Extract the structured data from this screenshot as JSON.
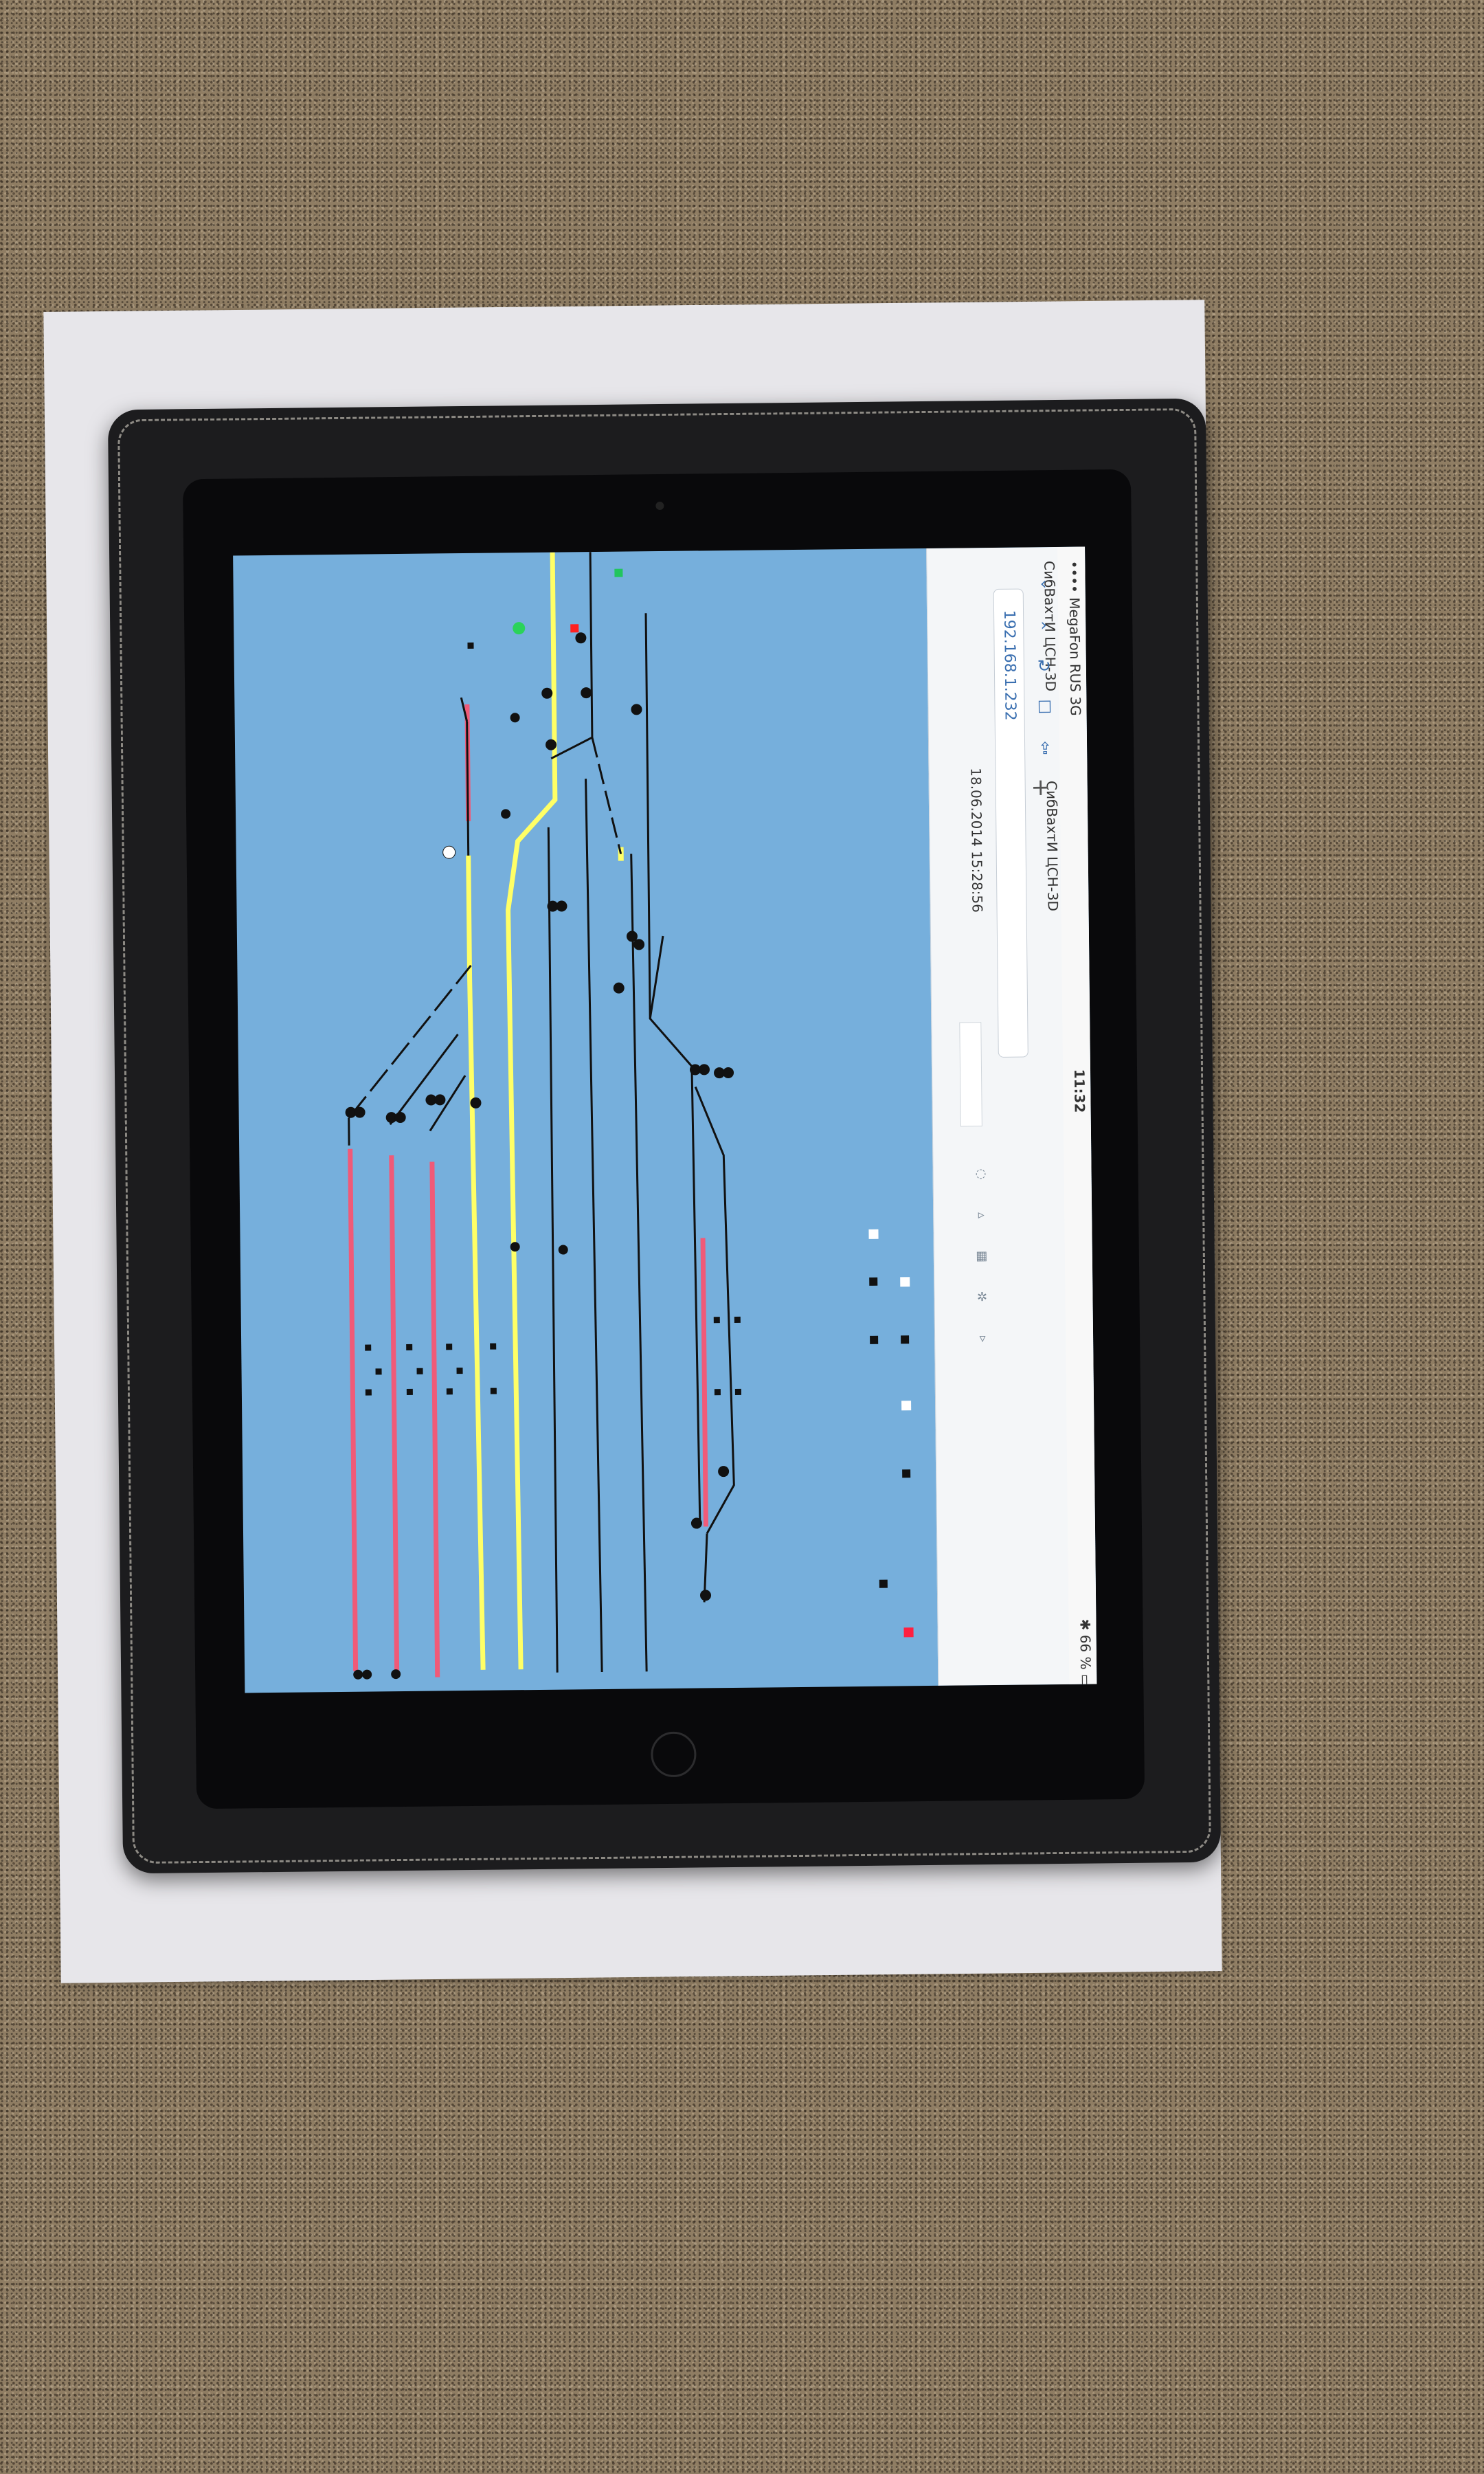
{
  "status_bar": {
    "carrier": "•••• MegaFon RUS 3G",
    "clock": "11:32",
    "battery": "✱ 66 % ▭"
  },
  "browser": {
    "tab_title": "СибВахтИ ЦСН-3D",
    "tab_title_2": "СибВахтИ ЦСН-3D",
    "url": "192.168.1.232",
    "timestamp": "18.06.2014 15:28:56",
    "nav_icons": [
      "back-icon",
      "forward-icon",
      "reload-icon",
      "bookmarks-icon",
      "share-icon",
      "tabs-icon"
    ]
  },
  "schematic": {
    "track_colors": {
      "occupied": "#f05a78",
      "route_set": "#ffff66",
      "free": "#111111",
      "background": "#76afdc"
    },
    "signal_aspects": [
      "green",
      "red",
      "white",
      "yellow"
    ],
    "legend_icons": [
      "white-square-icon",
      "red-square-icon",
      "black-square-icon"
    ]
  },
  "colors": {
    "screen_bg": "#76afdc",
    "case": "#1c1c1e",
    "paper": "#e7e6ea",
    "surface": "#8f7d63"
  }
}
